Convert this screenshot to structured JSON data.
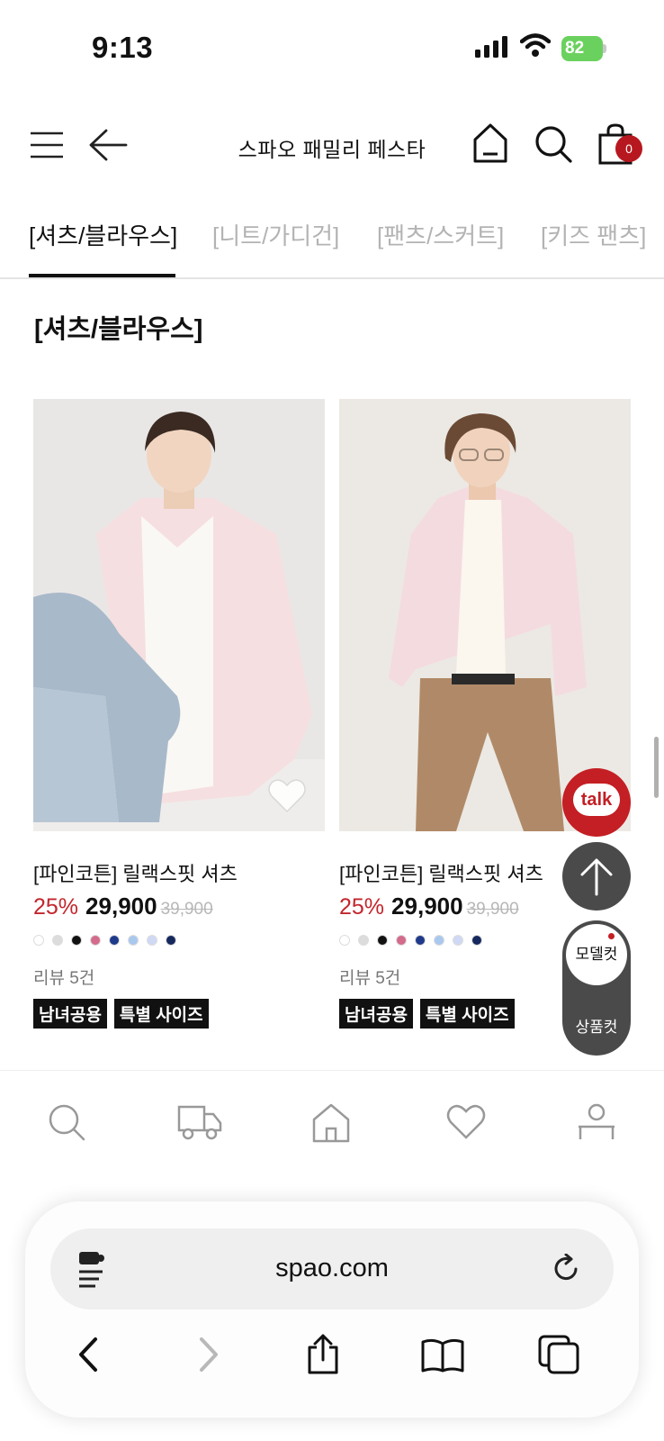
{
  "status_bar": {
    "time": "9:13",
    "battery_level": "82",
    "battery_color": "#6bd15e",
    "icons": [
      "signal-icon",
      "wifi-icon",
      "battery-icon"
    ]
  },
  "header": {
    "title": "스파오 패밀리 페스타",
    "cart_count": "0",
    "icons": [
      "menu-icon",
      "back-arrow-icon",
      "home-icon",
      "search-icon",
      "cart-icon"
    ]
  },
  "tabs": [
    {
      "label": "[셔츠/블라우스]",
      "active": true
    },
    {
      "label": "[니트/가디건]",
      "active": false
    },
    {
      "label": "[팬츠/스커트]",
      "active": false
    },
    {
      "label": "[키즈 팬츠]",
      "active": false
    }
  ],
  "section_title": "[셔츠/블라우스]",
  "products": [
    {
      "name": "[파인코튼] 릴랙스핏 셔츠",
      "discount": "25%",
      "price": "29,900",
      "original_price": "39,900",
      "swatch_colors": [
        "#ffffff",
        "#dcdcdc",
        "#111111",
        "#d46a8c",
        "#1f3a8a",
        "#a9c8ee",
        "#cfd9f5",
        "#15285e"
      ],
      "review": "리뷰 5건",
      "tags": [
        "남녀공용",
        "특별 사이즈"
      ],
      "wishlist": true
    },
    {
      "name": "[파인코튼] 릴랙스핏 셔츠",
      "discount": "25%",
      "price": "29,900",
      "original_price": "39,900",
      "swatch_colors": [
        "#ffffff",
        "#dcdcdc",
        "#111111",
        "#d46a8c",
        "#1f3a8a",
        "#a9c8ee",
        "#cfd9f5",
        "#15285e"
      ],
      "review": "리뷰 5건",
      "tags": [
        "남녀공용",
        "특별 사이즈"
      ],
      "wishlist": false
    }
  ],
  "floating": {
    "talk_label": "talk",
    "model_cut_label": "모델컷",
    "product_cut_label": "상품컷",
    "accent_color": "#c31f24"
  },
  "bottom_nav": [
    "search-icon",
    "delivery-truck-icon",
    "home-icon",
    "heart-icon",
    "user-icon"
  ],
  "browser": {
    "url": "spao.com",
    "icons": [
      "extension-icon",
      "reload-icon",
      "back-icon",
      "forward-icon",
      "share-icon",
      "bookmarks-icon",
      "tabs-icon"
    ]
  }
}
